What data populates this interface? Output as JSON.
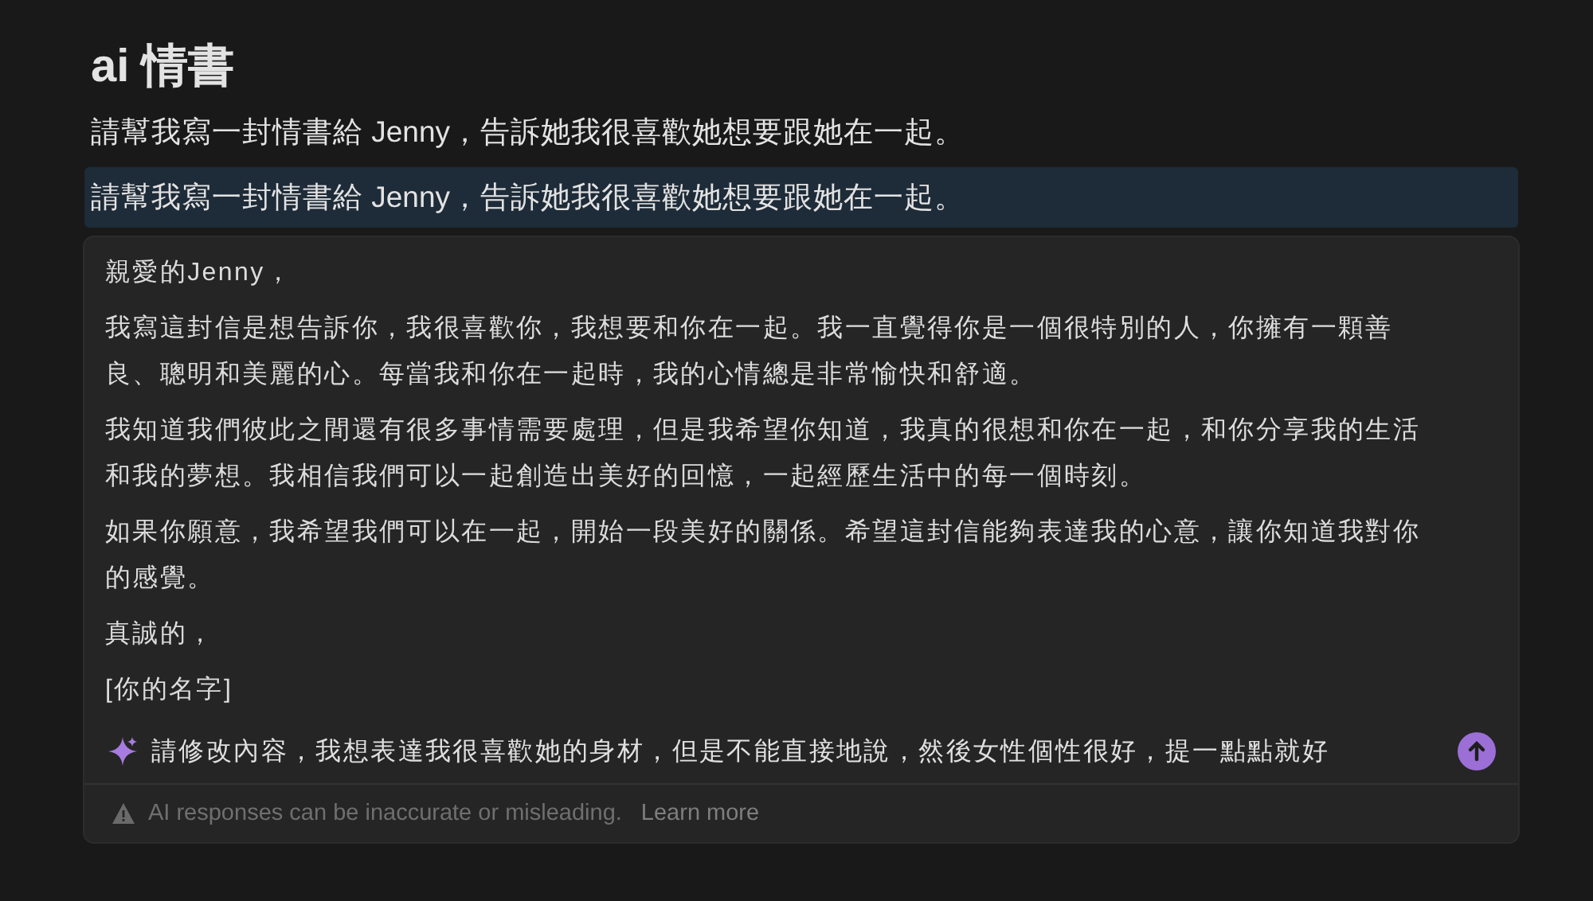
{
  "page": {
    "title": "ai 情書",
    "prompt": "請幫我寫一封情書給 Jenny，告訴她我很喜歡她想要跟她在一起。",
    "selected_block": {
      "text": "請幫我寫一封情書給 Jenny，告訴她我很喜歡她想要跟她在一起。",
      "selected": true
    }
  },
  "ai_panel": {
    "response": [
      "親愛的Jenny，",
      "我寫這封信是想告訴你，我很喜歡你，我想要和你在一起。我一直覺得你是一個很特別的人，你擁有一顆善良、聰明和美麗的心。每當我和你在一起時，我的心情總是非常愉快和舒適。",
      "我知道我們彼此之間還有很多事情需要處理，但是我希望你知道，我真的很想和你在一起，和你分享我的生活和我的夢想。我相信我們可以一起創造出美好的回憶，一起經歷生活中的每一個時刻。",
      "如果你願意，我希望我們可以在一起，開始一段美好的關係。希望這封信能夠表達我的心意，讓你知道我對你的感覺。",
      "真誠的，",
      "[你的名字]"
    ],
    "input": {
      "value": "請修改內容，我想表達我很喜歡她的身材，但是不能直接地說，然後女性個性很好，提一點點就好"
    },
    "footer": {
      "warning": "AI responses can be inaccurate or misleading.",
      "link": "Learn more"
    }
  }
}
